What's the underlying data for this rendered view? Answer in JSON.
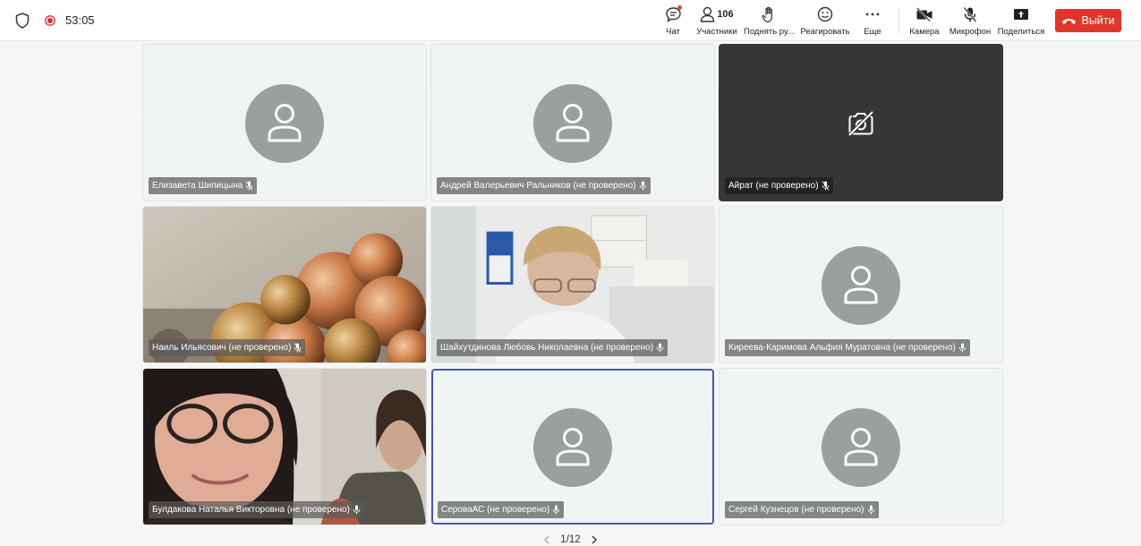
{
  "topbar": {
    "timer": "53:05",
    "chat_label": "Чат",
    "participants_label": "Участники",
    "participants_count": "106",
    "raise_hand_label": "Поднять ру...",
    "react_label": "Реагировать",
    "more_label": "Еще",
    "camera_label": "Камера",
    "mic_label": "Микрофон",
    "share_label": "Поделиться",
    "leave_label": "Выйти"
  },
  "tiles": [
    {
      "name": "Елизавета Шипицына",
      "type": "avatar"
    },
    {
      "name": "Андрей Валерьевич Ральников (не проверено)",
      "type": "avatar"
    },
    {
      "name": "Айрат (не проверено)",
      "type": "camera-off"
    },
    {
      "name": "Наиль Ильясович (не проверено)",
      "type": "video"
    },
    {
      "name": "Шайхутдинова Любовь Николаевна (не проверено)",
      "type": "video"
    },
    {
      "name": "Киреева-Каримова Альфия Муратовна (не проверено)",
      "type": "avatar"
    },
    {
      "name": "Булдакова Наталья Викторовна (не проверено)",
      "type": "video"
    },
    {
      "name": "СероваАС (не проверено)",
      "type": "avatar"
    },
    {
      "name": "Сергей Кузнецов (не проверено)",
      "type": "avatar"
    }
  ],
  "pager": {
    "page": "1/12"
  },
  "colors": {
    "leave": "#e0352b",
    "active_border": "#4a55a8",
    "rec": "#d9302b"
  }
}
